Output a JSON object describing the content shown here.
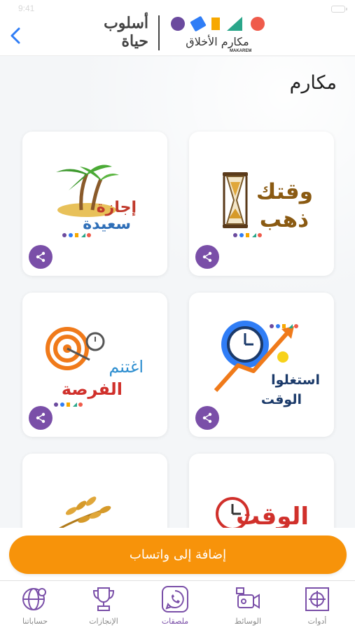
{
  "status_bar": {
    "time": "9:41"
  },
  "header": {
    "logo_left_line1": "أسلوب",
    "logo_left_line2": "حياة",
    "brand_name": "مكارم الأخلاق",
    "brand_sub": "MAKAREM"
  },
  "section": {
    "title": "مكارم"
  },
  "cards": [
    {
      "line1": "وقتك",
      "line2": "ذهب",
      "icon": "hourglass-icon"
    },
    {
      "line1": "إجازة",
      "line2": "سعيدة",
      "icon": "palm-island-icon"
    },
    {
      "line1": "استغلوا",
      "line2": "الوقت",
      "icon": "gear-clock-icon"
    },
    {
      "line1": "اغتنم",
      "line2": "الفرصة",
      "icon": "target-icon"
    },
    {
      "line1": "الوقت",
      "line2": "",
      "icon": "clock-icon"
    },
    {
      "line1": "",
      "line2": "",
      "icon": "wheat-icon"
    }
  ],
  "actions": {
    "add_to_whatsapp": "إضافة إلى واتساب"
  },
  "tabs": [
    {
      "label": "أدوات",
      "icon": "crosshair-icon"
    },
    {
      "label": "الوسائط",
      "icon": "video-camera-icon"
    },
    {
      "label": "ملصقات",
      "icon": "whatsapp-icon"
    },
    {
      "label": "الإنجازات",
      "icon": "trophy-icon"
    },
    {
      "label": "حساباتنا",
      "icon": "globe-icon"
    }
  ],
  "colors": {
    "accent_purple": "#7a4fa8",
    "whatsapp_button": "#f7930a",
    "back_arrow": "#2f7df6"
  }
}
